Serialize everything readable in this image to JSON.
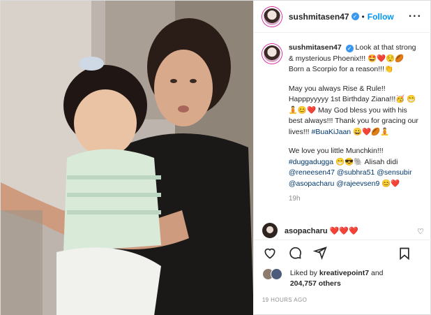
{
  "post": {
    "username": "sushmitasen47",
    "separator": "•",
    "follow_label": "Follow",
    "more_label": "···",
    "caption": {
      "p1": "Look at that strong & mysterious Phoenix!!! 🤩❤️😌🏉 Born a Scorpio for a reason!!!👏",
      "p2a": "May you always Rise & Rule!! Happpyyyyy 1st Birthday Ziana!!!🥳 😁🧘😊❤️ May God bless you with his best always!!! Thank you for gracing our lives!!! ",
      "p2_tag": "#BuaKiJaan",
      "p2b": " 😀❤️🏉🧘",
      "p3a": "We love you little Munchkin!!! ",
      "p3_tag1": "#duggadugga",
      "p3b": " 😁😎🐘 Alisah didi ",
      "p3_tag2": "@reneesen47",
      "p3_tag3": "@subhra51",
      "p3_tag4": "@sensubir",
      "p3_tag5": "@asopacharu",
      "p3_tag6": "@rajeevsen9",
      "p3c": " 😊❤️"
    },
    "time_ago": "19h",
    "comment": {
      "username": "asopacharu",
      "text": "❤️❤️❤️"
    },
    "likes": {
      "prefix": "Liked by ",
      "liker": "kreativepoint7",
      "middle": " and",
      "count": "204,757 others"
    },
    "timestamp": "19 HOURS AGO"
  },
  "icons": {
    "like": "heart-icon",
    "comment": "comment-icon",
    "share": "share-icon",
    "save": "bookmark-icon",
    "verified": "verified-badge-icon"
  },
  "colors": {
    "accent": "#0095f6",
    "verified": "#3897f0",
    "hashtag": "#00376b",
    "muted": "#8e8e8e"
  }
}
